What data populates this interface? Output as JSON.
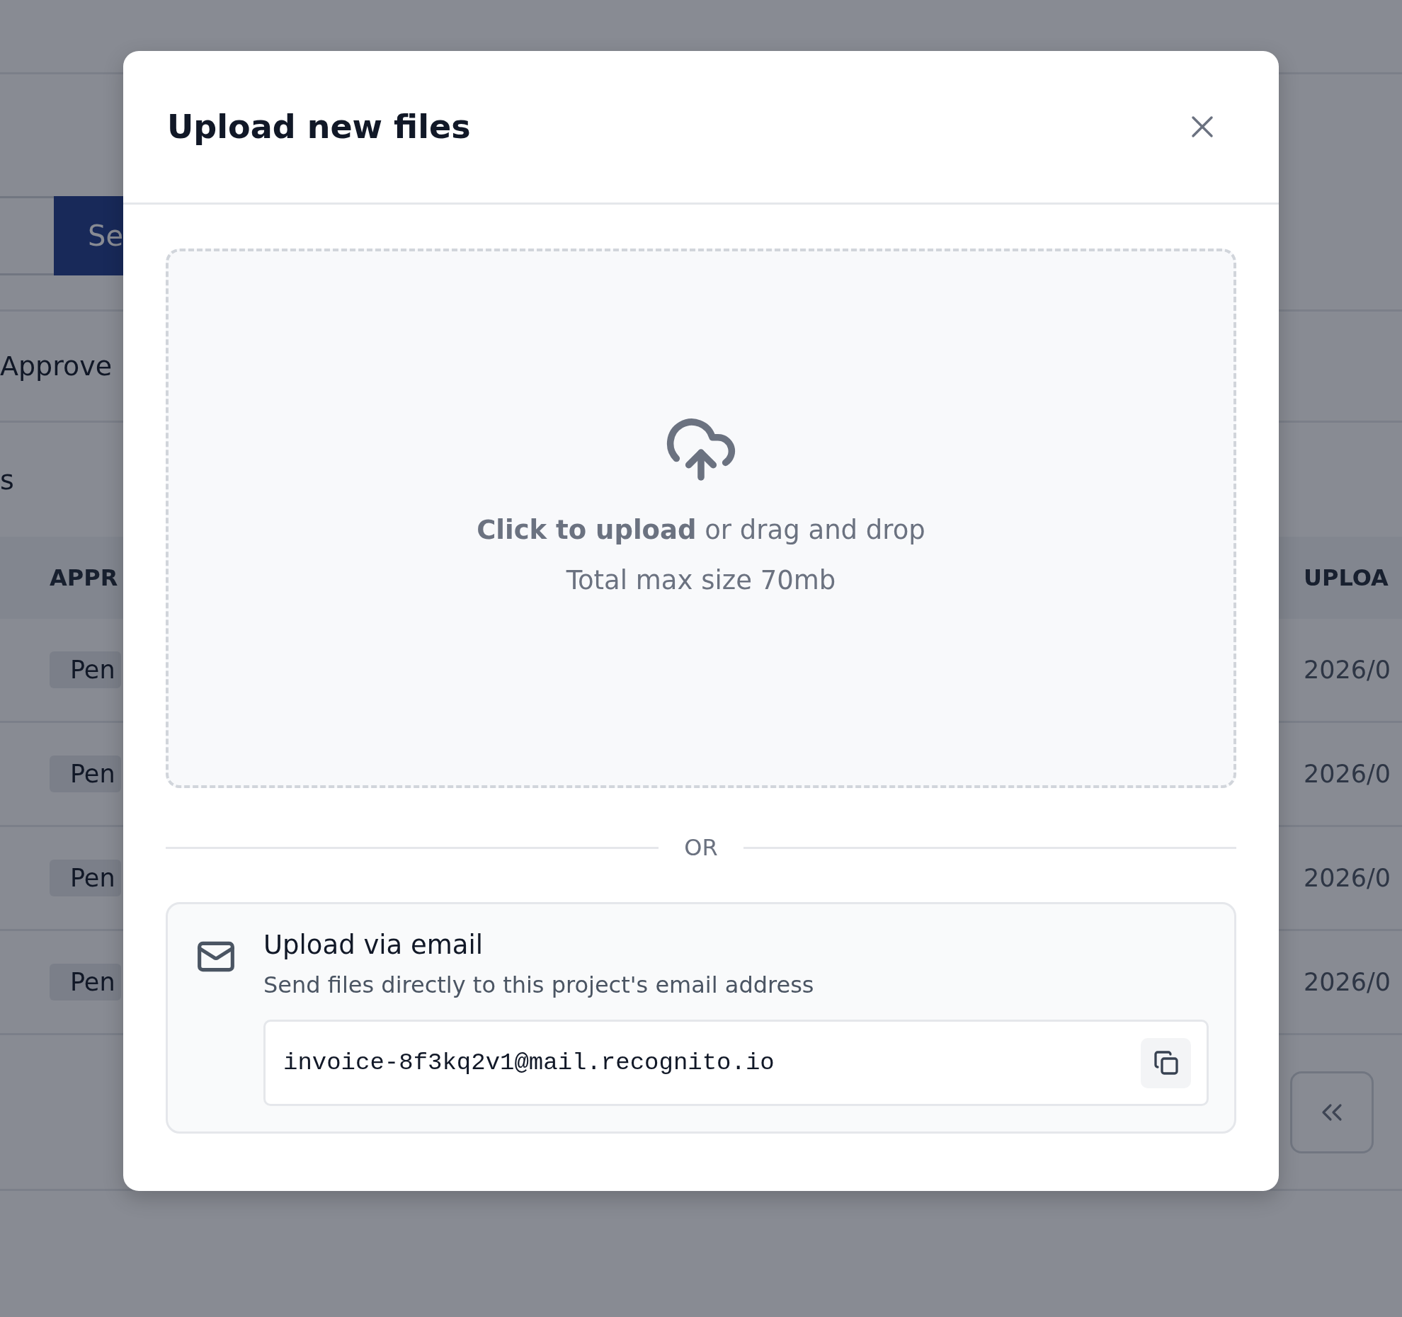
{
  "background": {
    "search_button": "Se",
    "filters": [
      {
        "label": "Approve"
      },
      {
        "label": "s"
      }
    ],
    "table": {
      "columns": [
        "APPR",
        "UPLOA"
      ],
      "rows": [
        {
          "status": "Pen",
          "date": "2026/0"
        },
        {
          "status": "Pen",
          "date": "2026/0"
        },
        {
          "status": "Pen",
          "date": "2026/0"
        },
        {
          "status": "Pen",
          "date": "2026/0"
        }
      ]
    }
  },
  "modal": {
    "title": "Upload new files",
    "dropzone": {
      "prompt": "**Click to upload** or drag and drop",
      "limit": "Total max size 70mb"
    },
    "divider": "OR",
    "email": {
      "title": "Upload via email",
      "description": "Send files directly to this project's email address",
      "address": "invoice-8f3kq2v1@mail.recognito.io"
    }
  }
}
